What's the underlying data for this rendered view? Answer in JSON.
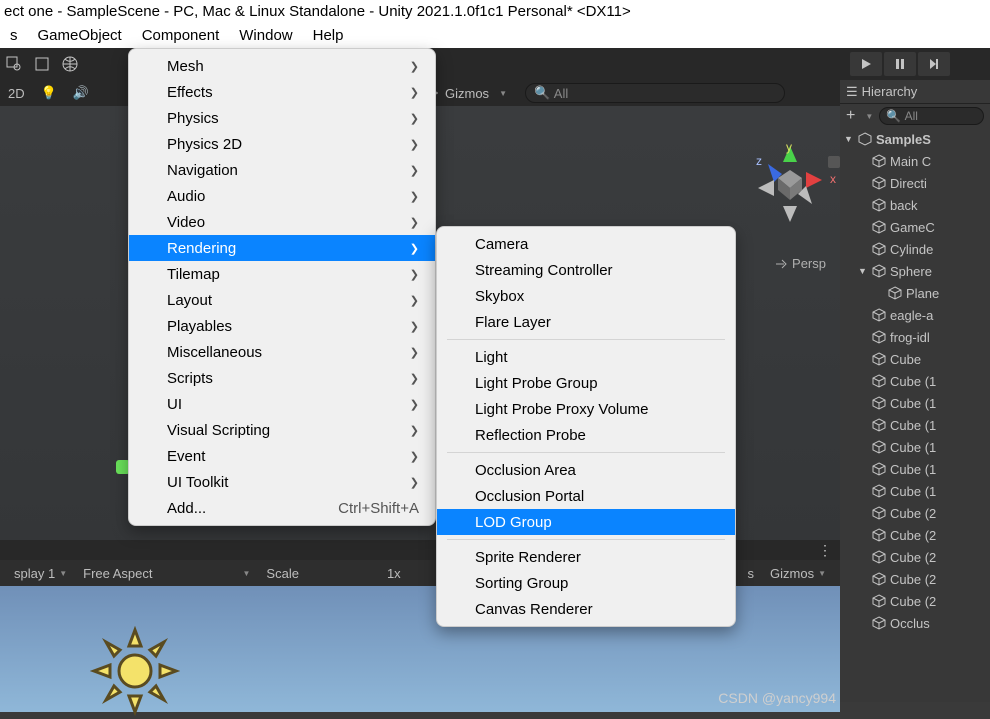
{
  "title": "ect one - SampleScene - PC, Mac & Linux Standalone - Unity 2021.1.0f1c1 Personal* <DX11>",
  "menubar": [
    "s",
    "GameObject",
    "Component",
    "Window",
    "Help"
  ],
  "sceneTabs": {
    "view2d": "2D",
    "gizmos": "Gizmos",
    "searchPlaceholder": "All"
  },
  "componentMenu": [
    {
      "label": "Mesh",
      "arrow": true
    },
    {
      "label": "Effects",
      "arrow": true
    },
    {
      "label": "Physics",
      "arrow": true
    },
    {
      "label": "Physics 2D",
      "arrow": true
    },
    {
      "label": "Navigation",
      "arrow": true
    },
    {
      "label": "Audio",
      "arrow": true
    },
    {
      "label": "Video",
      "arrow": true
    },
    {
      "label": "Rendering",
      "arrow": true,
      "selected": true
    },
    {
      "label": "Tilemap",
      "arrow": true
    },
    {
      "label": "Layout",
      "arrow": true
    },
    {
      "label": "Playables",
      "arrow": true
    },
    {
      "label": "Miscellaneous",
      "arrow": true
    },
    {
      "label": "Scripts",
      "arrow": true
    },
    {
      "label": "UI",
      "arrow": true
    },
    {
      "label": "Visual Scripting",
      "arrow": true
    },
    {
      "label": "Event",
      "arrow": true
    },
    {
      "label": "UI Toolkit",
      "arrow": true
    },
    {
      "label": "Add...",
      "shortcut": "Ctrl+Shift+A"
    }
  ],
  "renderingMenu": [
    {
      "label": "Camera"
    },
    {
      "label": "Streaming Controller"
    },
    {
      "label": "Skybox"
    },
    {
      "label": "Flare Layer"
    },
    {
      "sep": true
    },
    {
      "label": "Light"
    },
    {
      "label": "Light Probe Group"
    },
    {
      "label": "Light Probe Proxy Volume"
    },
    {
      "label": "Reflection Probe"
    },
    {
      "sep": true
    },
    {
      "label": "Occlusion Area"
    },
    {
      "label": "Occlusion Portal"
    },
    {
      "label": "LOD Group",
      "selected": true
    },
    {
      "sep": true
    },
    {
      "label": "Sprite Renderer"
    },
    {
      "label": "Sorting Group"
    },
    {
      "label": "Canvas Renderer"
    }
  ],
  "persp": "Persp",
  "gizmoAxes": {
    "x": "x",
    "y": "y",
    "z": "z"
  },
  "hierarchy": {
    "tab": "Hierarchy",
    "searchPlaceholder": "All",
    "plus": "+",
    "root": "SampleS",
    "items": [
      {
        "l": "Main C",
        "d": 1
      },
      {
        "l": "Directi",
        "d": 1
      },
      {
        "l": "back",
        "d": 1
      },
      {
        "l": "GameC",
        "d": 1
      },
      {
        "l": "Cylinde",
        "d": 1
      },
      {
        "l": "Sphere",
        "d": 1,
        "arrow": "▼"
      },
      {
        "l": "Plane",
        "d": 2
      },
      {
        "l": "eagle-a",
        "d": 1
      },
      {
        "l": "frog-idl",
        "d": 1
      },
      {
        "l": "Cube",
        "d": 1
      },
      {
        "l": "Cube (1",
        "d": 1
      },
      {
        "l": "Cube (1",
        "d": 1
      },
      {
        "l": "Cube (1",
        "d": 1
      },
      {
        "l": "Cube (1",
        "d": 1
      },
      {
        "l": "Cube (1",
        "d": 1
      },
      {
        "l": "Cube (1",
        "d": 1
      },
      {
        "l": "Cube (2",
        "d": 1
      },
      {
        "l": "Cube (2",
        "d": 1
      },
      {
        "l": "Cube (2",
        "d": 1
      },
      {
        "l": "Cube (2",
        "d": 1
      },
      {
        "l": "Cube (2",
        "d": 1
      },
      {
        "l": "Occlus",
        "d": 1
      }
    ]
  },
  "gamebar": {
    "display": "splay 1",
    "aspect": "Free Aspect",
    "scale": "Scale",
    "scaleVal": "1x",
    "gizmos": "Gizmos",
    "s": "s"
  },
  "watermark": "CSDN @yancy994"
}
